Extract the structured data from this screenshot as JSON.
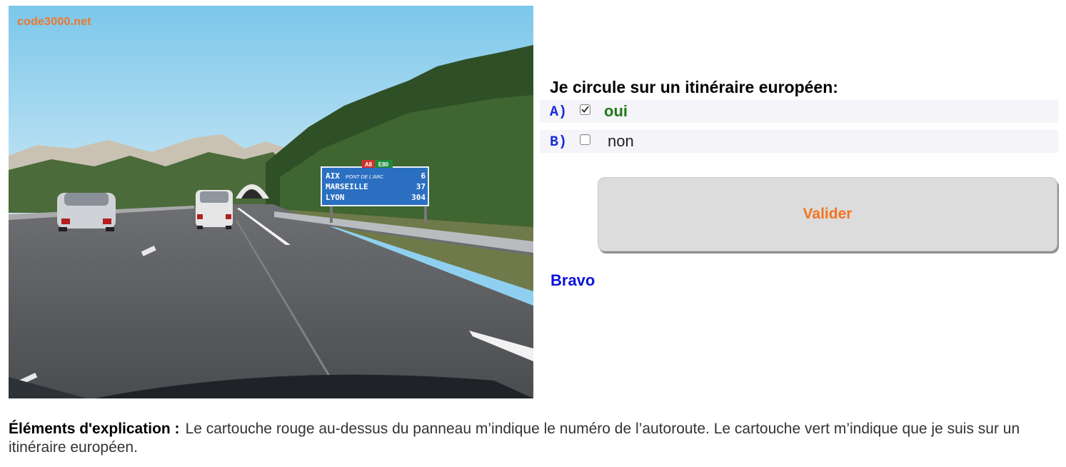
{
  "scene": {
    "watermark": "code3000.net",
    "sign": {
      "route_cartouches": [
        "A8",
        "E80"
      ],
      "destinations": [
        {
          "name": "AIX",
          "sub": "PONT DE L'ARC",
          "distance": "6"
        },
        {
          "name": "MARSEILLE",
          "sub": "",
          "distance": "37"
        },
        {
          "name": "LYON",
          "sub": "",
          "distance": "304"
        }
      ]
    }
  },
  "quiz": {
    "question": "Je circule sur un itinéraire européen:",
    "answers": [
      {
        "letter": "A)",
        "text": "oui",
        "checked": true
      },
      {
        "letter": "B)",
        "text": "non",
        "checked": false
      }
    ],
    "validate_label": "Valider",
    "result": "Bravo"
  },
  "explanation": {
    "label": "Éléments d'explication :",
    "text": "Le cartouche rouge au-dessus du panneau m’indique le numéro de l’autoroute. Le cartouche vert m’indique que je suis sur un itinéraire européen."
  },
  "colors": {
    "accent_orange": "#f37421",
    "answer_letter_blue": "#1b2bd6",
    "correct_green": "#1f7a16",
    "result_blue": "#0a14d8",
    "sign_blue": "#2b6fc1",
    "cartouche_red": "#d2312c",
    "cartouche_green": "#1f8a3b"
  }
}
